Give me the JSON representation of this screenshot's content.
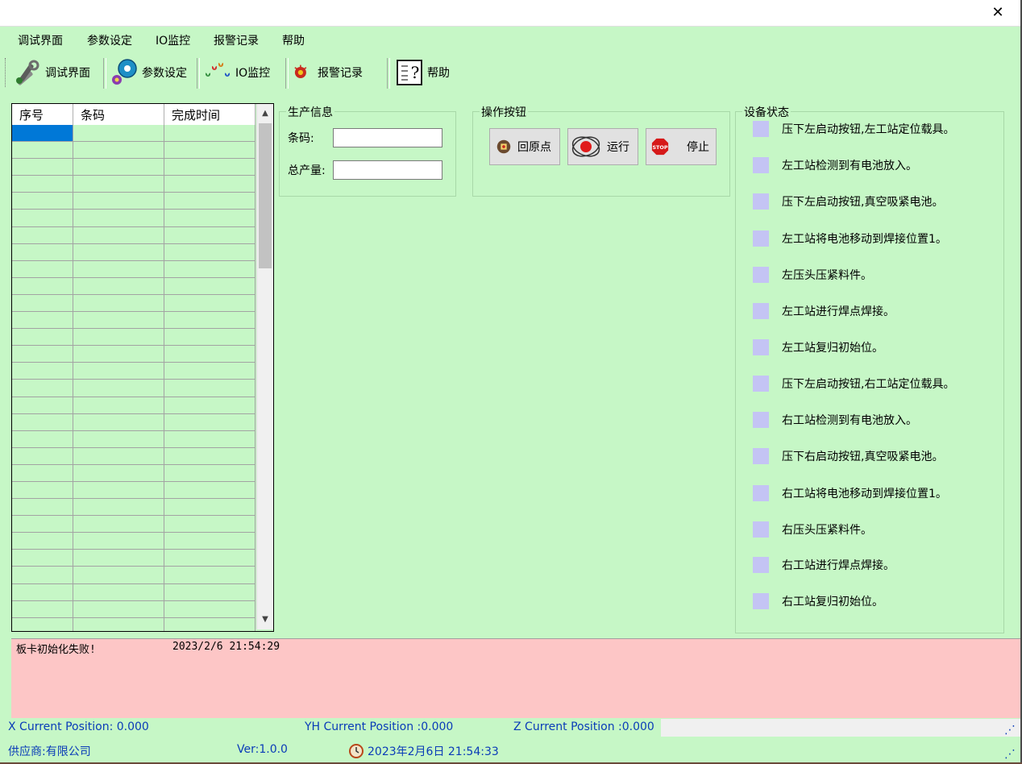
{
  "window": {
    "close_symbol": "✕"
  },
  "menu": [
    "调试界面",
    "参数设定",
    "IO监控",
    "报警记录",
    "帮助"
  ],
  "toolbar": [
    {
      "label": "调试界面",
      "icon": "tools-icon"
    },
    {
      "label": "参数设定",
      "icon": "gear-disc-icon"
    },
    {
      "label": "IO监控",
      "icon": "droplets-icon"
    },
    {
      "label": "报警记录",
      "icon": "alarm-icon"
    },
    {
      "label": "帮助",
      "icon": "help-icon"
    }
  ],
  "grid": {
    "columns": [
      "序号",
      "条码",
      "完成时间"
    ],
    "row_count": 30,
    "selected_row": 0
  },
  "production": {
    "title": "生产信息",
    "barcode_label": "条码:",
    "barcode_value": "",
    "total_label": "总产量:",
    "total_value": ""
  },
  "operations": {
    "title": "操作按钮",
    "buttons": [
      "回原点",
      "运行",
      "停止"
    ]
  },
  "device_status": {
    "title": "设备状态",
    "items": [
      "压下左启动按钮,左工站定位载具。",
      "左工站检测到有电池放入。",
      "压下左启动按钮,真空吸紧电池。",
      "左工站将电池移动到焊接位置1。",
      "左压头压紧料件。",
      "左工站进行焊点焊接。",
      "左工站复归初始位。",
      "压下左启动按钮,右工站定位载具。",
      "右工站检测到有电池放入。",
      "压下右启动按钮,真空吸紧电池。",
      "右工站将电池移动到焊接位置1。",
      "右压头压紧料件。",
      "右工站进行焊点焊接。",
      "右工站复归初始位。"
    ],
    "indicator_color": "#c4c4f4"
  },
  "log": {
    "message": "板卡初始化失败!",
    "time": "2023/2/6 21:54:29"
  },
  "positions": {
    "x": "X Current Position: 0.000",
    "yh": "YH Current Position :0.000",
    "z": "Z Current Position :0.000"
  },
  "status_bar": {
    "supplier": "供应商:有限公司",
    "version": "Ver:1.0.0",
    "datetime": "2023年2月6日 21:54:33"
  },
  "colors": {
    "background": "#c6f7c6",
    "log_background": "#fdc6c6",
    "status_text": "#0a3cb8",
    "selection": "#0078d7"
  }
}
